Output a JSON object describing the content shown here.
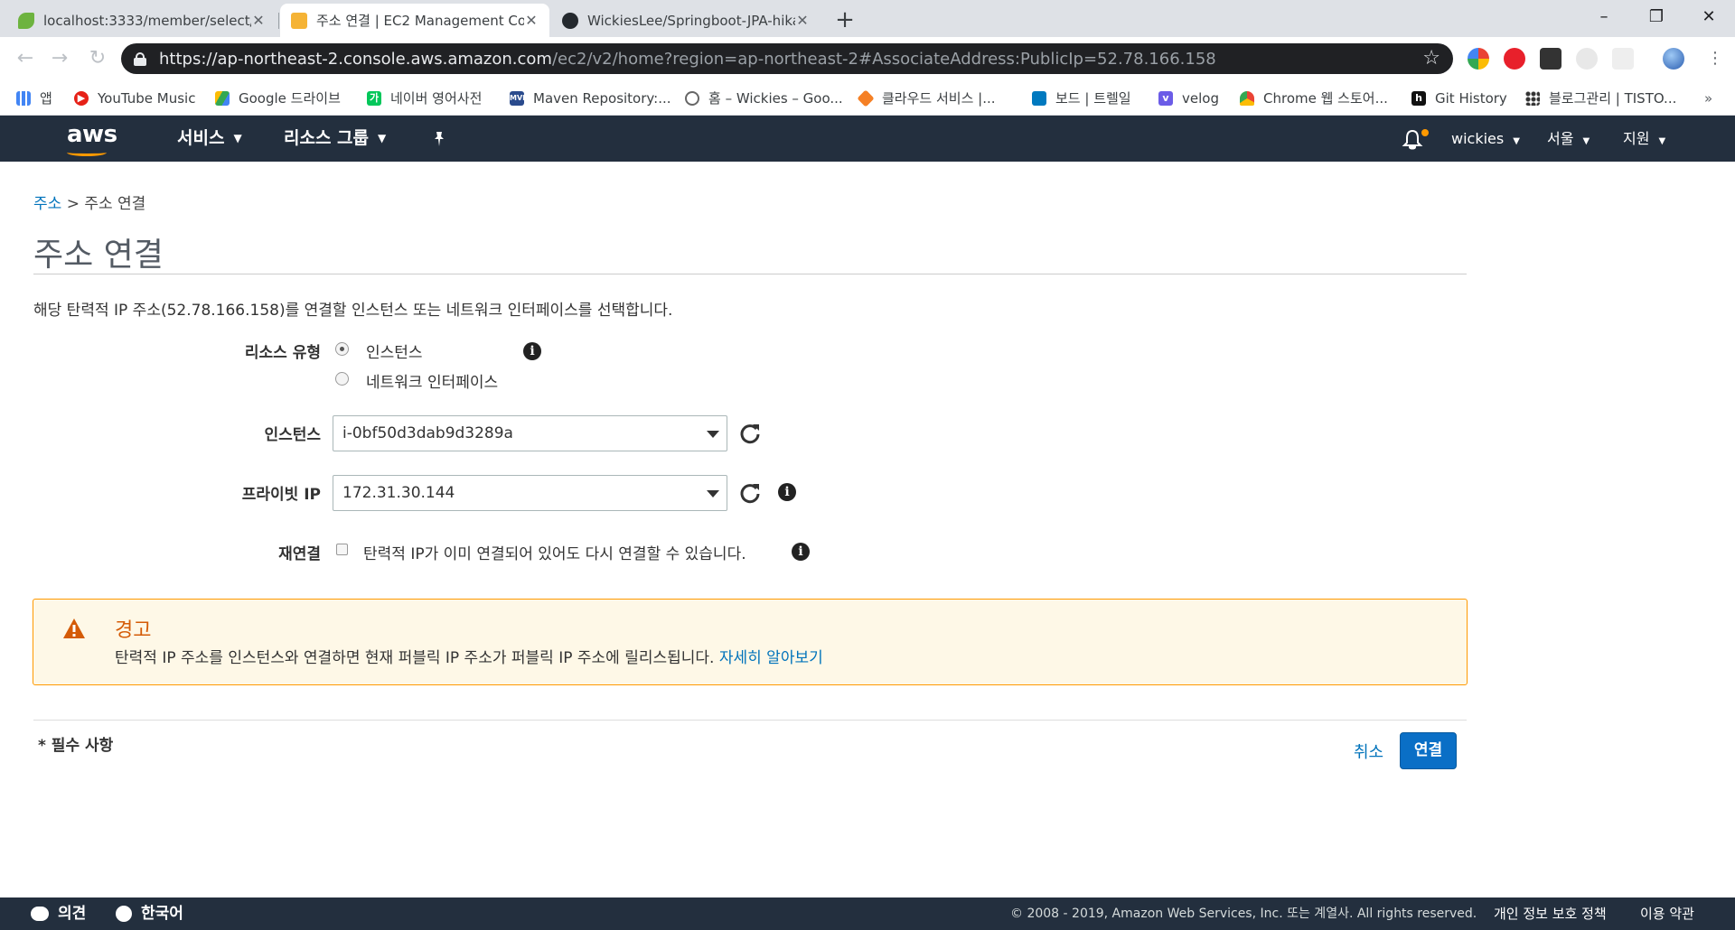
{
  "browser": {
    "tabs": [
      {
        "title": "localhost:3333/member/select/",
        "active": false,
        "favicon": "spring-leaf-icon"
      },
      {
        "title": "주소 연결 | EC2 Management Co",
        "active": true,
        "favicon": "aws-box-icon"
      },
      {
        "title": "WickiesLee/Springboot-JPA-hika",
        "active": false,
        "favicon": "github-icon"
      }
    ],
    "new_tab": "+",
    "window_controls": {
      "minimize": "–",
      "restore": "❐",
      "close": "✕"
    },
    "url_host": "https://ap-northeast-2.console.aws.amazon.com",
    "url_rest": "/ec2/v2/home?region=ap-northeast-2#AssociateAddress:PublicIp=52.78.166.158",
    "bookmarks": [
      {
        "label": "앱",
        "icon": "apps-grid-icon"
      },
      {
        "label": "YouTube Music",
        "icon": "youtube-music-icon"
      },
      {
        "label": "Google 드라이브",
        "icon": "google-drive-icon"
      },
      {
        "label": "네이버 영어사전",
        "icon": "naver-dictionary-icon"
      },
      {
        "label": "Maven Repository:...",
        "icon": "maven-icon"
      },
      {
        "label": "홈 – Wickies – Goo...",
        "icon": "google-sites-icon"
      },
      {
        "label": "클라우드 서비스 |...",
        "icon": "cloud-service-icon"
      },
      {
        "label": "보드 | 트렐일",
        "icon": "trello-icon"
      },
      {
        "label": "velog",
        "icon": "velog-icon"
      },
      {
        "label": "Chrome 웹 스토어...",
        "icon": "chrome-webstore-icon"
      },
      {
        "label": "Git History",
        "icon": "git-history-icon"
      },
      {
        "label": "블로그관리 | TISTO...",
        "icon": "tistory-icon"
      }
    ],
    "more": "»"
  },
  "aws_nav": {
    "logo": "aws",
    "services": "서비스",
    "resource_groups": "리소스 그룹",
    "user": "wickies",
    "region": "서울",
    "support": "지원"
  },
  "page": {
    "breadcrumb_link": "주소",
    "breadcrumb_sep": ">",
    "breadcrumb_current": "주소 연결",
    "title": "주소 연결",
    "intro": "해당 탄력적 IP 주소(52.78.166.158)를 연결할 인스턴스 또는 네트워크 인터페이스를 선택합니다."
  },
  "form": {
    "resource_type_label": "리소스 유형",
    "option_instance": "인스턴스",
    "option_network_interface": "네트워크 인터페이스",
    "selected_resource_type": "인스턴스",
    "instance_label": "인스턴스",
    "instance_value": "i-0bf50d3dab9d3289a",
    "private_ip_label": "프라이빗 IP",
    "private_ip_value": "172.31.30.144",
    "reassociate_label": "재연결",
    "reassociate_text": "탄력적 IP가 이미 연결되어 있어도 다시 연결할 수 있습니다.",
    "reassociate_checked": false
  },
  "warning": {
    "title": "경고",
    "text": "탄력적 IP 주소를 인스턴스와 연결하면 현재 퍼블릭 IP 주소가 퍼블릭 IP 주소에 릴리스됩니다.",
    "link": "자세히 알아보기",
    "color": "#ff9900"
  },
  "actions": {
    "required_note": "* 필수 사항",
    "cancel": "취소",
    "associate": "연결",
    "primary_color": "#0a6fc6"
  },
  "footer": {
    "feedback": "의견",
    "language": "한국어",
    "copyright": "© 2008 - 2019, Amazon Web Services, Inc. 또는 계열사. All rights reserved.",
    "privacy": "개인 정보 보호 정책",
    "terms": "이용 약관"
  }
}
